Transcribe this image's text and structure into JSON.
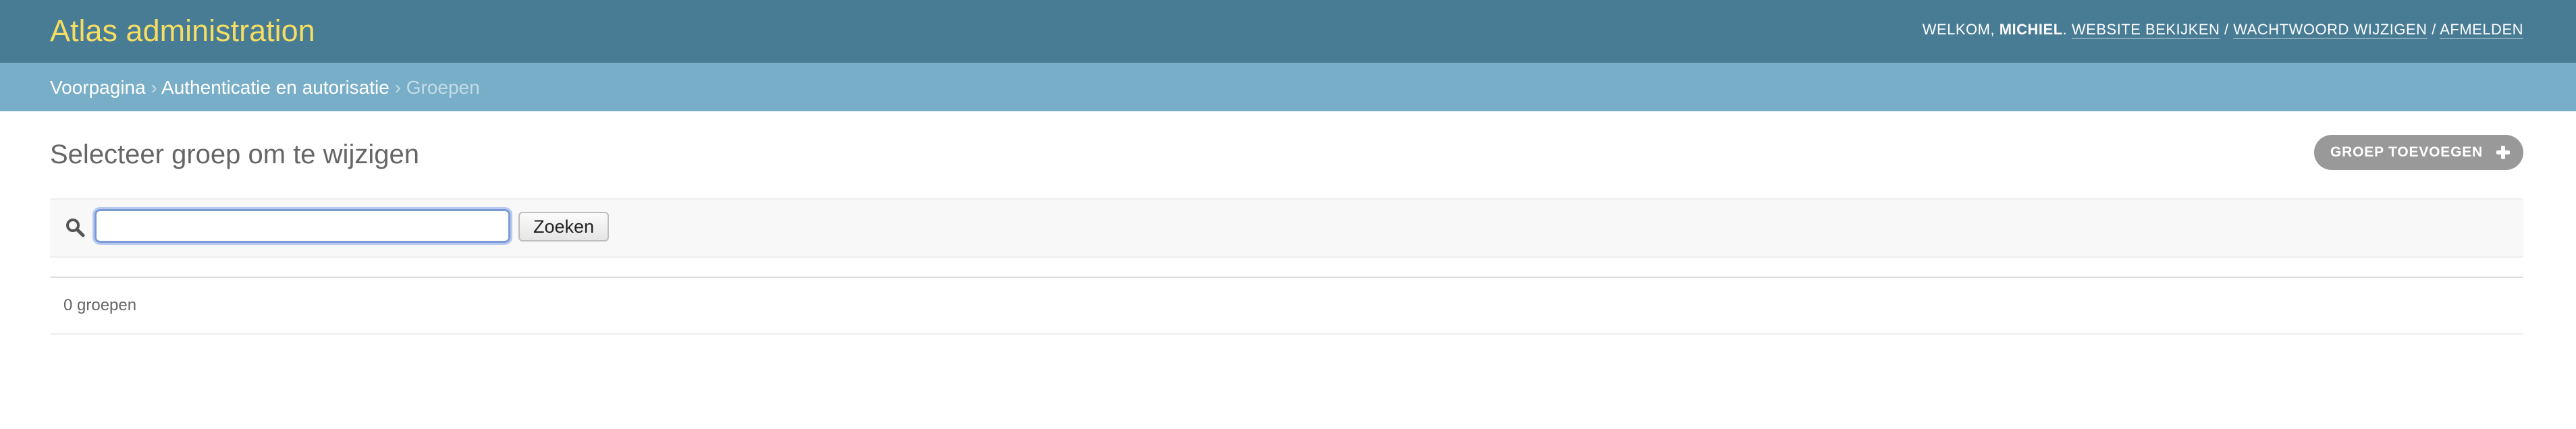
{
  "header": {
    "site_name": "Atlas administration",
    "welcome_prefix": "Welkom, ",
    "username": "Michiel",
    "welcome_suffix": ". ",
    "links": {
      "view_site": "Website bekijken",
      "change_password": "Wachtwoord wijzigen",
      "logout": "Afmelden"
    },
    "separator": " / "
  },
  "breadcrumbs": {
    "home": "Voorpagina",
    "app": "Authenticatie en autorisatie",
    "current": "Groepen",
    "arrow": " › "
  },
  "main": {
    "title": "Selecteer groep om te wijzigen",
    "add_button": "Groep toevoegen",
    "search": {
      "value": "",
      "placeholder": "",
      "button_label": "Zoeken",
      "icon": "search-icon"
    },
    "result_count": "0 groepen"
  },
  "colors": {
    "header_bg": "#417690",
    "brand": "#f5dd5d",
    "breadcrumbs_bg": "#79aec8",
    "add_button_bg": "#999999"
  }
}
